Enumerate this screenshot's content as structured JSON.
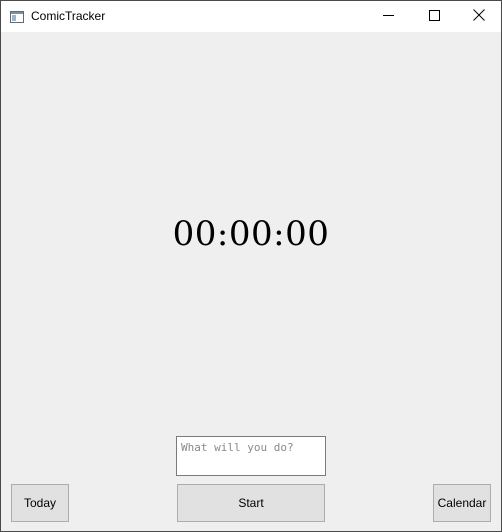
{
  "window": {
    "title": "ComicTracker",
    "app_icon": "window-app-icon",
    "controls": {
      "minimize_icon": "minimize-icon",
      "maximize_icon": "maximize-icon",
      "close_icon": "close-icon"
    }
  },
  "main": {
    "timer_display": "00:00:00",
    "task_input": {
      "value": "",
      "placeholder": "What will you do?"
    },
    "buttons": {
      "today_label": "Today",
      "start_label": "Start",
      "calendar_label": "Calendar"
    }
  },
  "colors": {
    "background": "#efefef",
    "titlebar": "#ffffff",
    "button_face": "#e1e1e1",
    "button_border": "#adadad"
  }
}
